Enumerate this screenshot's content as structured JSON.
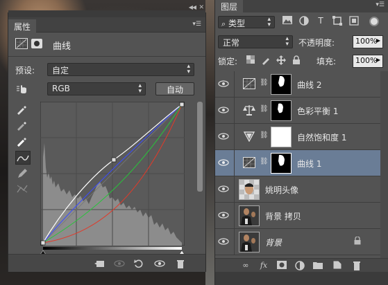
{
  "properties": {
    "tab_label": "属性",
    "adjustment_title": "曲线",
    "preset_label": "预设:",
    "preset_value": "自定",
    "channel_value": "RGB",
    "auto_label": "自动",
    "curve_points": [
      [
        0,
        0
      ],
      [
        100,
        100
      ]
    ]
  },
  "layers": {
    "tab_label": "图层",
    "filter_kind": "类型",
    "blend_mode": "正常",
    "opacity_label": "不透明度:",
    "opacity_value": "100%",
    "lock_label": "锁定:",
    "fill_label": "填充:",
    "fill_value": "100%",
    "items": [
      {
        "name": "曲线 2",
        "kind": "curves"
      },
      {
        "name": "色彩平衡 1",
        "kind": "color-balance"
      },
      {
        "name": "自然饱和度 1",
        "kind": "vibrance"
      },
      {
        "name": "曲线 1",
        "kind": "curves",
        "selected": true
      },
      {
        "name": "姚明头像",
        "kind": "image"
      },
      {
        "name": "背景 拷贝",
        "kind": "image"
      },
      {
        "name": "背景",
        "kind": "image",
        "locked": true
      }
    ]
  },
  "colors": {
    "panel": "#535353",
    "selected_row": "#6a7d96",
    "curve_rgb": "#ffffff",
    "curve_red": "#e03a2a",
    "curve_green": "#28c43a",
    "curve_blue": "#3a4cff"
  }
}
